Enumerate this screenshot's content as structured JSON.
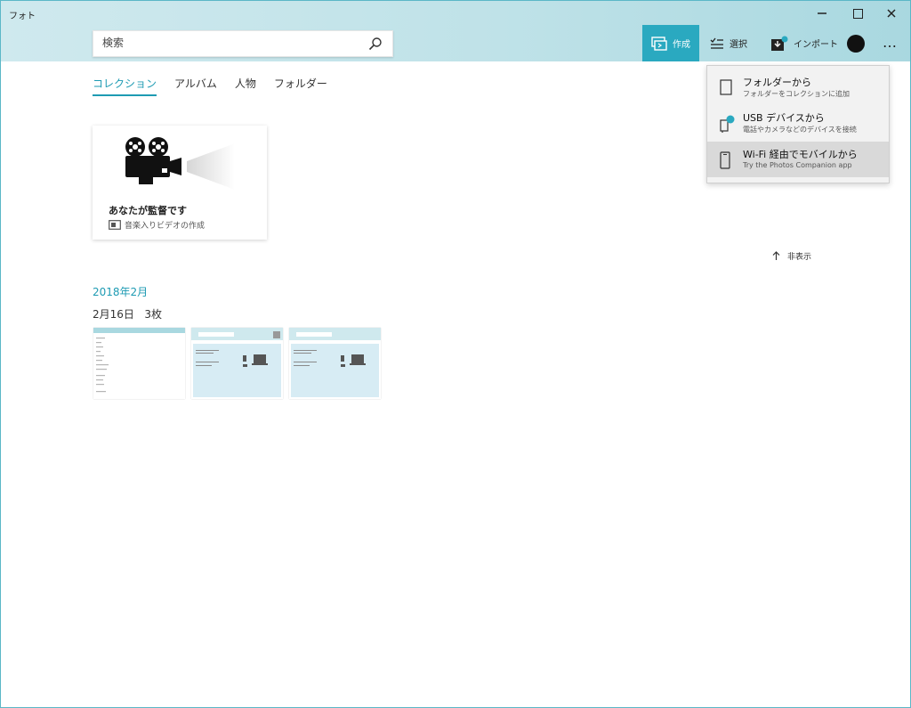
{
  "window": {
    "title": "フォト"
  },
  "search": {
    "placeholder": "検索"
  },
  "toolbar": {
    "create_label": "作成",
    "select_label": "選択",
    "import_label": "インポート",
    "more_label": "…"
  },
  "tabs": [
    {
      "label": "コレクション",
      "active": true
    },
    {
      "label": "アルバム",
      "active": false
    },
    {
      "label": "人物",
      "active": false
    },
    {
      "label": "フォルダー",
      "active": false
    }
  ],
  "card": {
    "title": "あなたが監督です",
    "subtitle": "音楽入りビデオの作成"
  },
  "hide_link": "非表示",
  "gallery": {
    "month": "2018年2月",
    "day_label": "2月16日",
    "count_label": "3枚"
  },
  "import_menu": {
    "items": [
      {
        "title": "フォルダーから",
        "subtitle": "フォルダーをコレクションに追加",
        "icon": "folder-icon",
        "highlighted": false
      },
      {
        "title": "USB デバイスから",
        "subtitle": "電話やカメラなどのデバイスを接続",
        "icon": "usb-device-icon",
        "highlighted": false
      },
      {
        "title": "Wi-Fi 経由でモバイルから",
        "subtitle": "Try the Photos Companion app",
        "icon": "mobile-icon",
        "highlighted": true
      }
    ]
  },
  "colors": {
    "accent": "#2aa9c0",
    "accent_text": "#1e9bb3",
    "menu_bg": "#f2f2f2",
    "menu_highlight": "#d9d9d9"
  }
}
